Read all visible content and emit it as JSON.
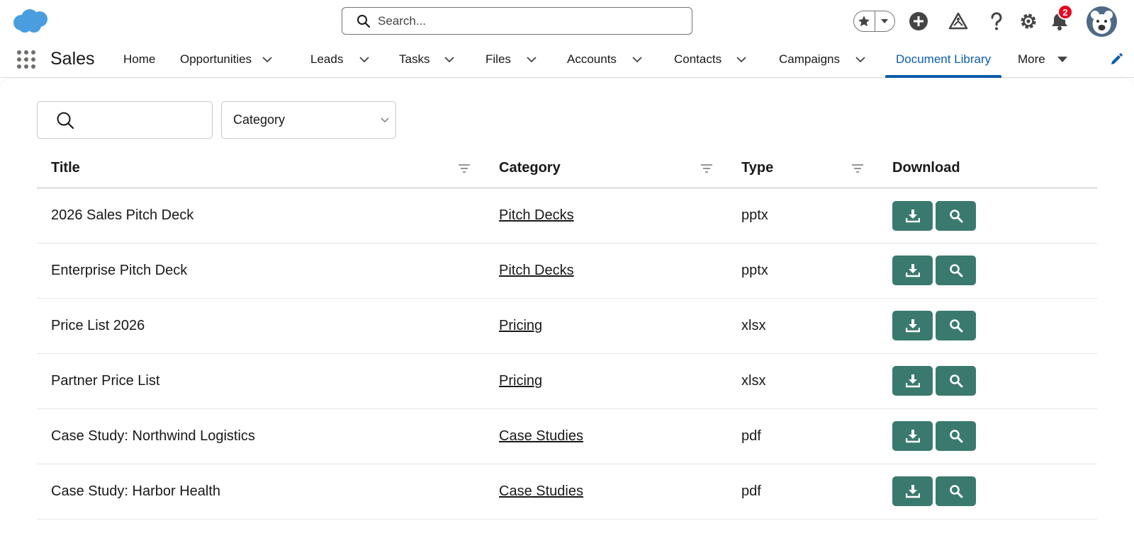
{
  "header": {
    "search_placeholder": "Search...",
    "notification_count": "2"
  },
  "nav": {
    "app_name": "Sales",
    "items": [
      {
        "label": "Home"
      },
      {
        "label": "Opportunities"
      },
      {
        "label": "Leads"
      },
      {
        "label": "Tasks"
      },
      {
        "label": "Files"
      },
      {
        "label": "Accounts"
      },
      {
        "label": "Contacts"
      },
      {
        "label": "Campaigns"
      },
      {
        "label": "Document Library"
      },
      {
        "label": "More"
      }
    ]
  },
  "filters": {
    "search_value": "",
    "category_selected": "Category"
  },
  "table": {
    "columns": [
      "Title",
      "Category",
      "Type",
      "Download"
    ],
    "rows": [
      {
        "title": "2026 Sales Pitch Deck",
        "category": "Pitch Decks",
        "type": "pptx"
      },
      {
        "title": "Enterprise Pitch Deck",
        "category": "Pitch Decks",
        "type": "pptx"
      },
      {
        "title": "Price List 2026",
        "category": "Pricing",
        "type": "xlsx"
      },
      {
        "title": "Partner Price List",
        "category": "Pricing",
        "type": "xlsx"
      },
      {
        "title": "Case Study: Northwind Logistics",
        "category": "Case Studies",
        "type": "pdf"
      },
      {
        "title": "Case Study: Harbor Health",
        "category": "Case Studies",
        "type": "pdf"
      }
    ]
  },
  "icons": {
    "logo": "cloud-logo",
    "download": "download-icon",
    "preview": "search-icon"
  },
  "colors": {
    "accent": "#0b5cab",
    "button": "#3a7a6e",
    "logo": "#4a9ee0",
    "badge": "#ea001e"
  }
}
